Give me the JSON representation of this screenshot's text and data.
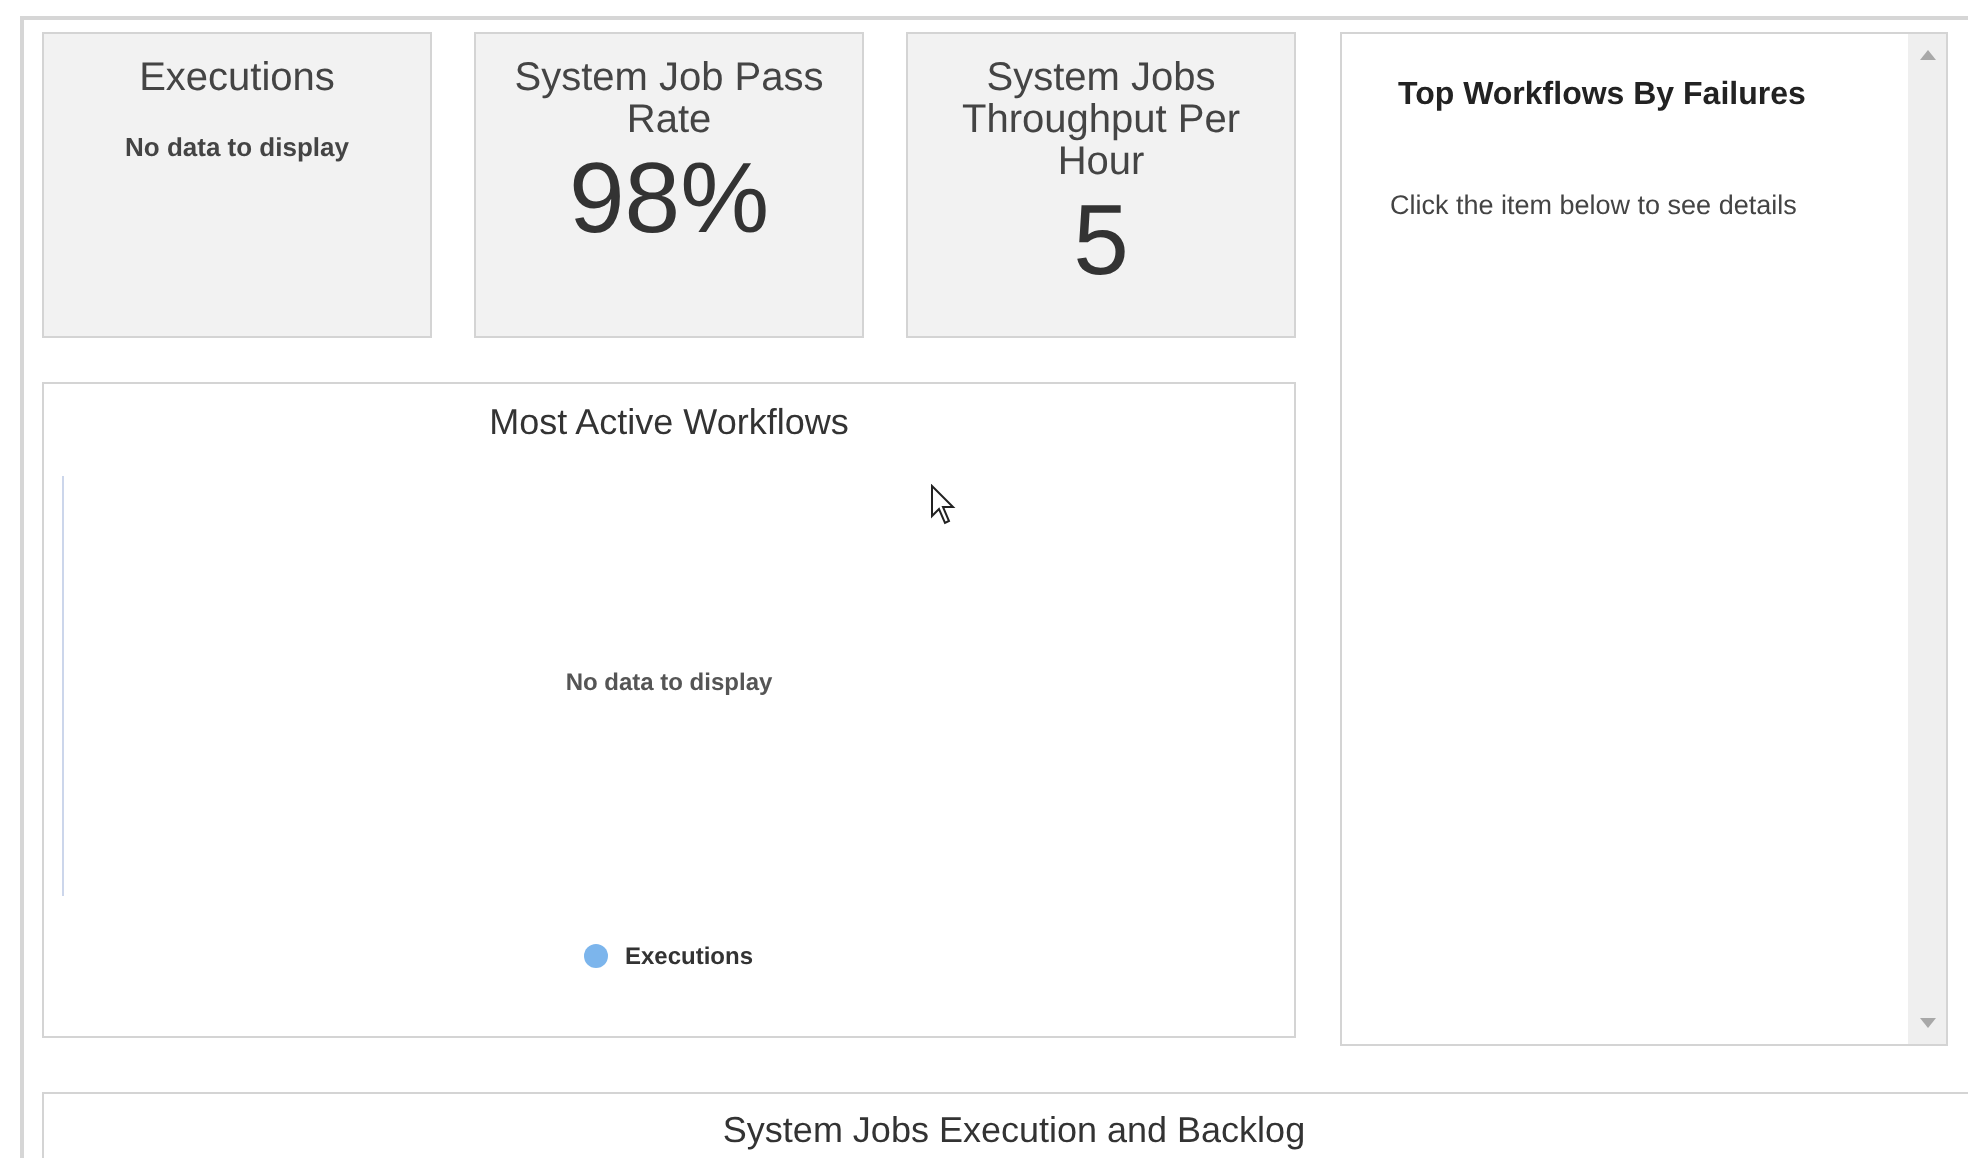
{
  "tiles": [
    {
      "title": "Executions",
      "kind": "empty",
      "message": "No data to display"
    },
    {
      "title": "System Job Pass Rate",
      "kind": "value",
      "value": "98%"
    },
    {
      "title": "System Jobs Throughput Per Hour",
      "kind": "value",
      "value": "5"
    }
  ],
  "most_active": {
    "title": "Most Active Workflows",
    "message": "No data to display",
    "legend": [
      {
        "label": "Executions",
        "color": "#7cb5ec"
      }
    ]
  },
  "top_failures": {
    "title": "Top Workflows By Failures",
    "hint": "Click the item below to see details"
  },
  "bottom_panel": {
    "title": "System Jobs Execution and Backlog"
  }
}
